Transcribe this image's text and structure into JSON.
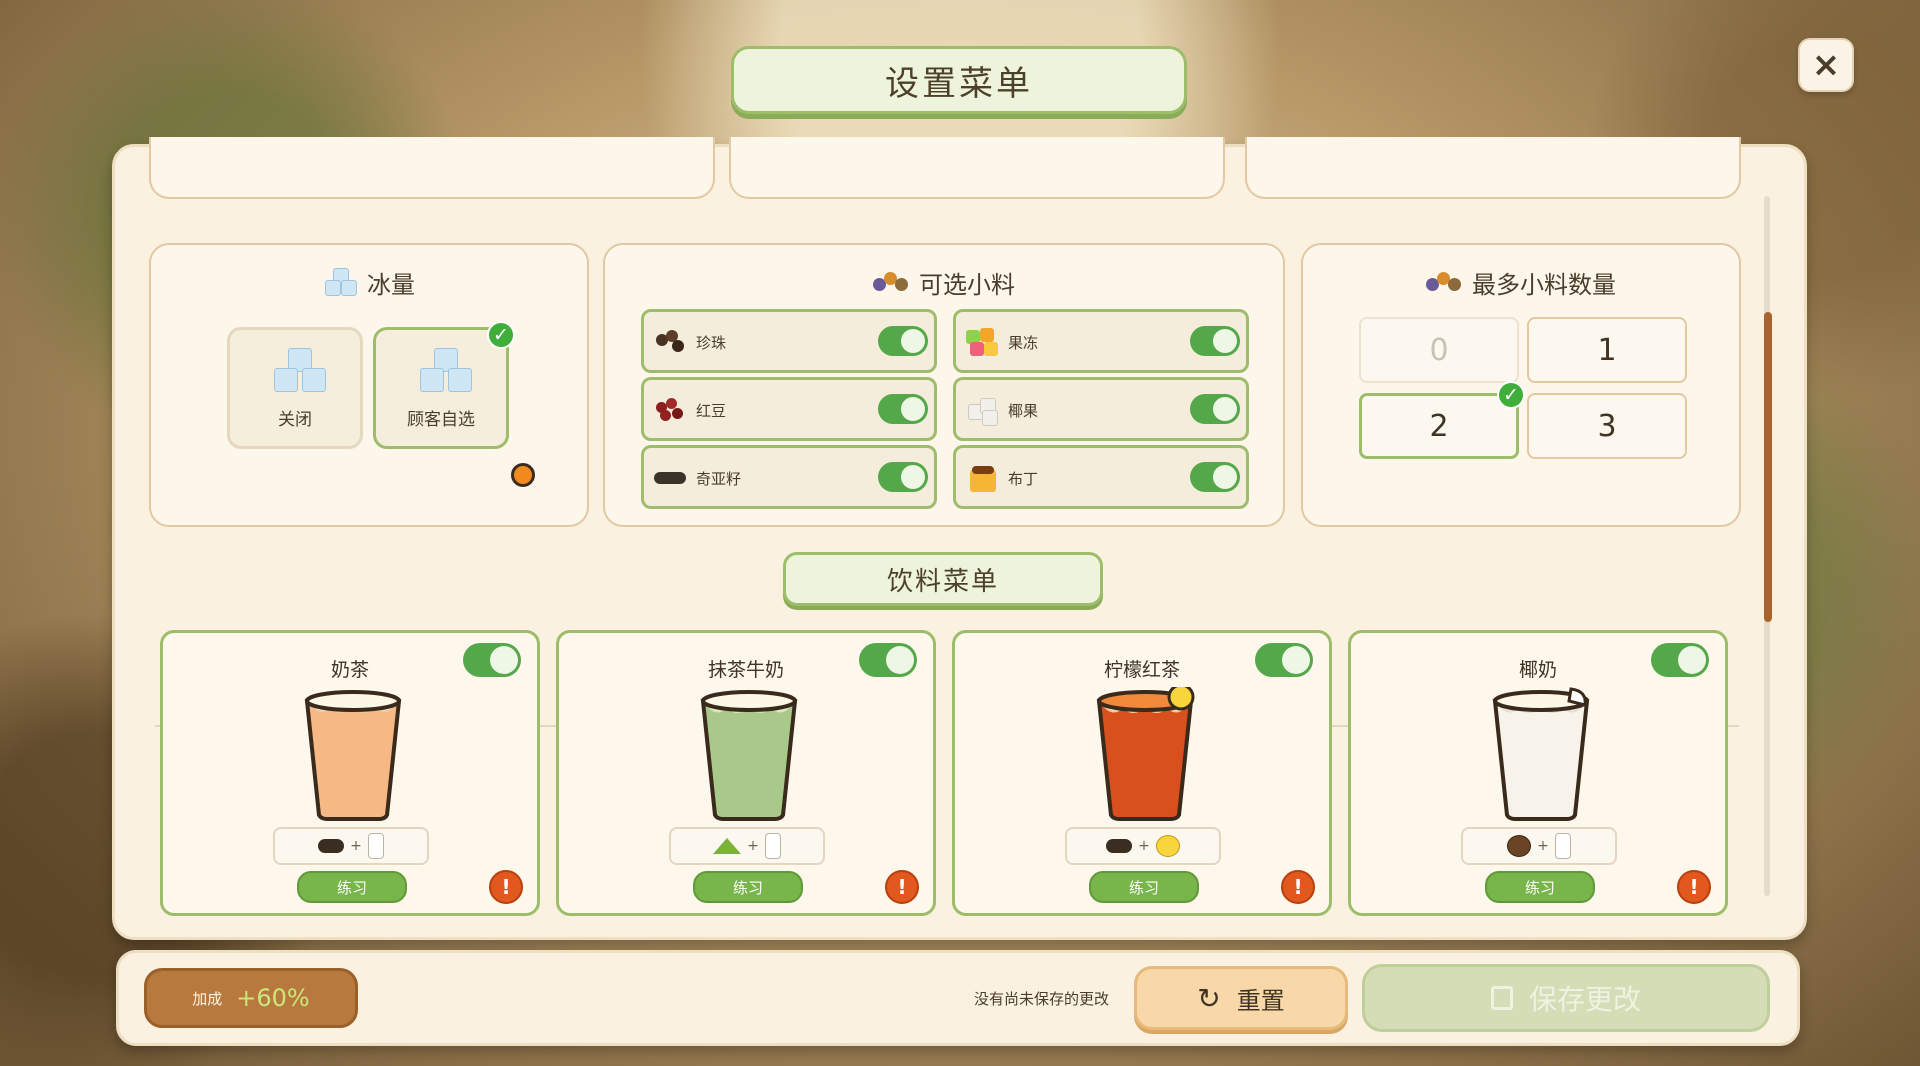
{
  "header": {
    "title": "设置菜单",
    "close_icon": "×"
  },
  "ice": {
    "title": "冰量",
    "options": [
      {
        "label": "关闭",
        "selected": false
      },
      {
        "label": "顾客自选",
        "selected": true
      }
    ]
  },
  "toppings": {
    "title": "可选小料",
    "items": [
      {
        "name": "珍珠",
        "icon": "pearl-icon",
        "enabled": true
      },
      {
        "name": "果冻",
        "icon": "jelly-icon",
        "enabled": true
      },
      {
        "name": "红豆",
        "icon": "red-bean-icon",
        "enabled": true
      },
      {
        "name": "椰果",
        "icon": "coconut-jelly-icon",
        "enabled": true
      },
      {
        "name": "奇亚籽",
        "icon": "chia-seed-icon",
        "enabled": true
      },
      {
        "name": "布丁",
        "icon": "pudding-icon",
        "enabled": true
      }
    ]
  },
  "max_toppings": {
    "title": "最多小料数量",
    "options": [
      "0",
      "1",
      "2",
      "3"
    ],
    "selected": "2",
    "disabled": [
      "0"
    ]
  },
  "drinks": {
    "title": "饮料菜单",
    "practice_label": "练习",
    "warn_icon": "!",
    "items": [
      {
        "name": "奶茶",
        "enabled": true,
        "cup_color": "#f6b985"
      },
      {
        "name": "抹茶牛奶",
        "enabled": true,
        "cup_color": "#a9c98a"
      },
      {
        "name": "柠檬红茶",
        "enabled": true,
        "cup_color": "#d8501d"
      },
      {
        "name": "椰奶",
        "enabled": true,
        "cup_color": "#f7f3ea"
      }
    ]
  },
  "footer": {
    "bonus_label": "加成",
    "bonus_value": "+60%",
    "unsaved_text": "没有尚未保存的更改",
    "reset_label": "重置",
    "reset_icon": "↻",
    "save_label": "保存更改"
  },
  "colors": {
    "accent_green": "#9dbd6a",
    "toggle_on": "#55a84a",
    "warning": "#e2591f",
    "bonus": "#b8793e"
  }
}
